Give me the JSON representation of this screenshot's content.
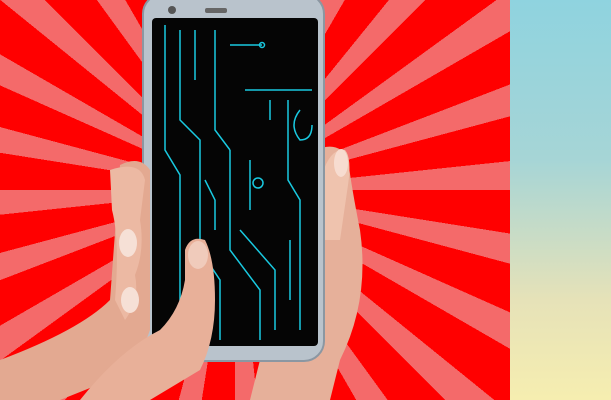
{
  "colors": {
    "ray_red": "#ff0000",
    "ray_pink": "#f46a6a",
    "side_top": "#8fd3df",
    "side_bottom": "#f6eeb0",
    "phone_frame": "#b9c3cc",
    "screen": "#050505",
    "circuit": "#19c9e0",
    "skin": "#e9b7a0"
  }
}
